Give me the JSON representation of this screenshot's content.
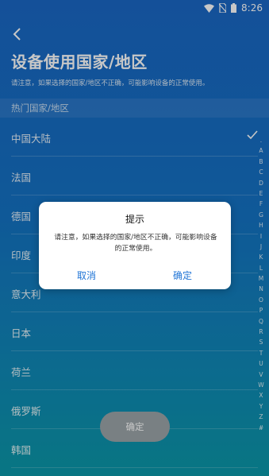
{
  "status_bar": {
    "time": "8:26",
    "icons": [
      "wifi-icon",
      "no-sim-icon",
      "battery-icon"
    ]
  },
  "header": {
    "back_icon": "back-arrow-icon",
    "title": "设备使用国家/地区",
    "warning": "请注意，如果选择的国家/地区不正确，可能影响设备的正常使用。"
  },
  "section": {
    "label": "热门国家/地区"
  },
  "countries": [
    {
      "name": "中国大陆",
      "selected": true
    },
    {
      "name": "法国",
      "selected": false
    },
    {
      "name": "德国",
      "selected": false
    },
    {
      "name": "印度",
      "selected": false
    },
    {
      "name": "意大利",
      "selected": false
    },
    {
      "name": "日本",
      "selected": false
    },
    {
      "name": "荷兰",
      "selected": false
    },
    {
      "name": "俄罗斯",
      "selected": false
    },
    {
      "name": "韩国",
      "selected": false
    }
  ],
  "alphabet": [
    ".",
    "A",
    "B",
    "C",
    "D",
    "E",
    "F",
    "G",
    "H",
    "I",
    "J",
    "K",
    "L",
    "M",
    "N",
    "O",
    "P",
    "Q",
    "R",
    "S",
    "T",
    "U",
    "V",
    "W",
    "X",
    "Y",
    "Z",
    "#"
  ],
  "bottom_button": {
    "label": "确定"
  },
  "dialog": {
    "title": "提示",
    "message": "请注意，如果选择的国家/地区不正确，可能影响设备的正常使用。",
    "cancel_label": "取消",
    "confirm_label": "确定"
  },
  "colors": {
    "accent": "#1f74d6",
    "background_top": "#1a67c4",
    "background_bottom": "#0b98a8",
    "disabled_button": "#9ba4a8"
  }
}
